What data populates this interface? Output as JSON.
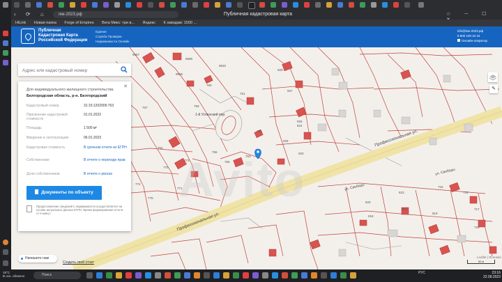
{
  "browser": {
    "url": "пкк-2023.рф",
    "page_title": "Публичная кадастровая карта",
    "bookmarks": [
      "HiLink",
      "Новая папка",
      "Forge of Empires",
      "Вега Микс: три в...",
      "Яндекс",
      "К заводам: 1500 ..."
    ]
  },
  "site": {
    "brand": [
      "Публичная",
      "Кадастровая Карта",
      "Российской Федерации"
    ],
    "service": [
      "Единая",
      "Служба Проверки",
      "Недвижимости Онлайн"
    ],
    "contact_email": "info@пкк-2023.рф",
    "contact_phone": "8 800 100 34 34",
    "online_operator": "Онлайн-оператор"
  },
  "search": {
    "placeholder": "Адрес или кадастровый номер"
  },
  "panel": {
    "title": "Для индивидуального жилищного строительства",
    "address": "Белгородская область, р-н. Белгородский",
    "rows": [
      {
        "label": "Кадастровый номер",
        "value": "31:15:1202005:763"
      },
      {
        "label": "Присвоение кадастровой стоимости",
        "value": "01.01.2022"
      },
      {
        "label": "Площадь",
        "value": "1 500 м²"
      },
      {
        "label": "Введение в эксплуатацию",
        "value": "06.01.2023"
      },
      {
        "label": "Кадастровая стоимость",
        "value": "В срочном отчете из ЕГРН"
      },
      {
        "label": "Собственники",
        "value": "В отчете о переходе прав"
      },
      {
        "label": "Доли собственников",
        "value": "В отчете о рисках"
      }
    ],
    "button": "Документы по объекту",
    "note": "Предоставление сведений о недвижимости осуществляется на основе актуальных данных ЕГРН. Время формирования отчета от 5 минут."
  },
  "map": {
    "watermark": "Avito",
    "streets": [
      "Профессиональная ул.",
      "Профессиональная ул.",
      "ул. Свободы",
      "ул. Свободы",
      "1-й Успенский пер."
    ],
    "parcel_numbers": [
      "9587",
      "9596",
      "9585",
      "9620",
      "767",
      "760",
      "761",
      "759",
      "762",
      "764",
      "765",
      "766",
      "763",
      "770",
      "774",
      "775",
      "771",
      "772",
      "768",
      "824",
      "929",
      "927",
      "926",
      "925",
      "933",
      "820",
      "823",
      "822",
      "818",
      "819",
      "716",
      "718",
      "717",
      "720"
    ],
    "attribution": "Leaflet | Ясенево",
    "scale": "50 м"
  },
  "controls": {
    "chat": "Напишите нам",
    "feedback": "Создать свой отчет"
  },
  "taskbar": {
    "temperature": "19°C",
    "weather": "В осн. облачно",
    "search_placeholder": "Поиск",
    "lang": "РУС",
    "time": "23:16",
    "date": "22.08.2023"
  },
  "colors": {
    "header": "#1565c0",
    "button": "#1e88e5",
    "parcel_line": "#c2413b",
    "house": "#d9534f",
    "road": "#f3e7b0"
  }
}
